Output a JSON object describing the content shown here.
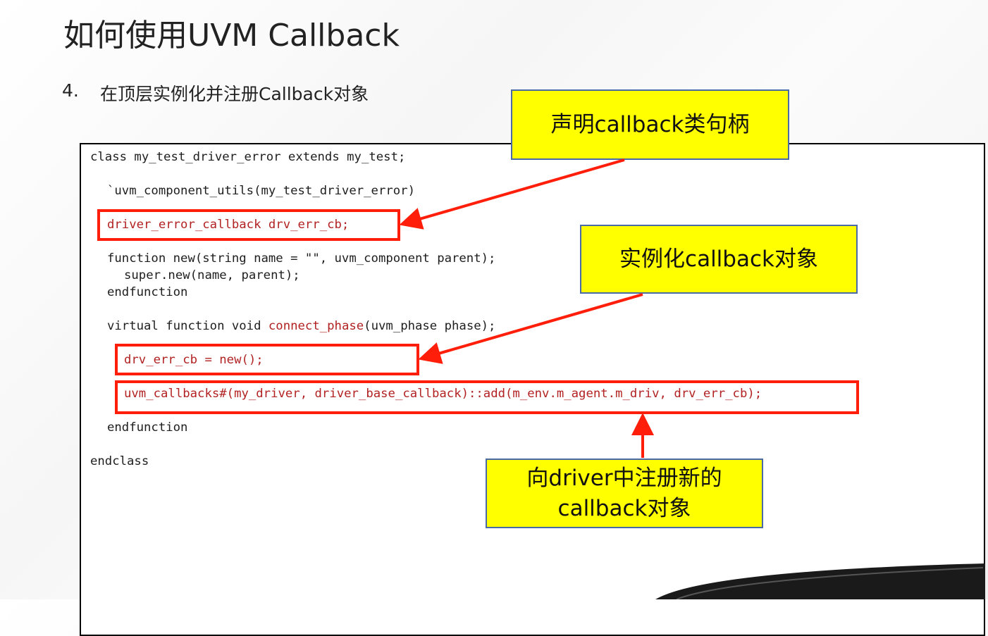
{
  "title": "如何使用UVM Callback",
  "step": {
    "number": "4.",
    "text": "在顶层实例化并注册Callback对象"
  },
  "code": {
    "line1": "class my_test_driver_error extends my_test;",
    "line2": "`uvm_component_utils(my_test_driver_error)",
    "line3": "driver_error_callback drv_err_cb;",
    "line4": "function new(string name = \"\", uvm_component parent);",
    "line5": "super.new(name, parent);",
    "line6": "endfunction",
    "line7_prefix": "virtual function void ",
    "line7_highlight": "connect_phase",
    "line7_suffix": "(uvm_phase phase);",
    "line8": "drv_err_cb = new();",
    "line9": "uvm_callbacks#(my_driver, driver_base_callback)::add(m_env.m_agent.m_driv, drv_err_cb);",
    "line10": "endfunction",
    "line11": "endclass"
  },
  "callouts": {
    "declare": "声明callback类句柄",
    "instantiate": "实例化callback对象",
    "register_line1": "向driver中注册新的",
    "register_line2": "callback对象"
  },
  "colors": {
    "highlight_box": "#ff1e0a",
    "callout_fill": "#ffff00",
    "callout_border": "#4a6aa5",
    "code_red": "#b22222"
  }
}
